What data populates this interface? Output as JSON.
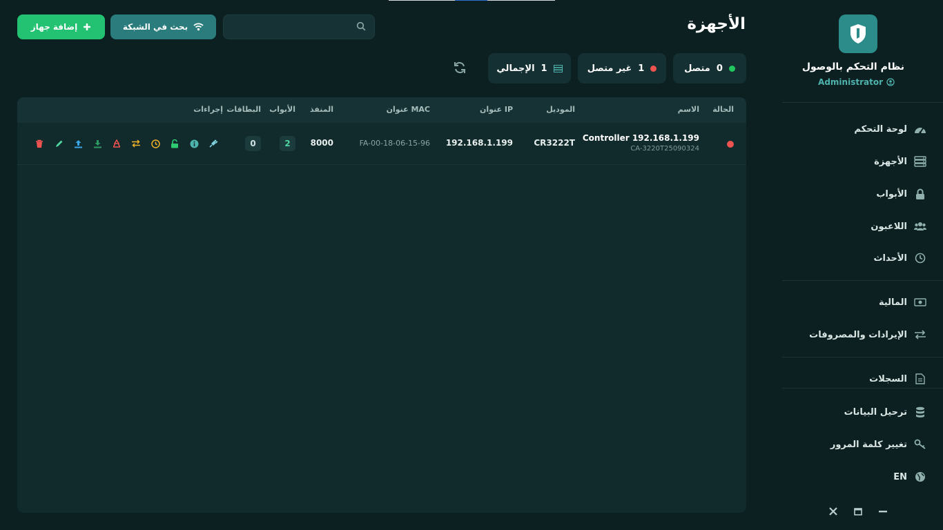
{
  "app": {
    "title": "نظام التحكم بالوصول",
    "role": "Administrator"
  },
  "nav": {
    "items": [
      {
        "label": "لوحة التحكم",
        "icon": "dashboard-icon"
      },
      {
        "label": "الأجهزة",
        "icon": "server-icon"
      },
      {
        "label": "الأبواب",
        "icon": "lock-icon"
      },
      {
        "label": "اللاعبون",
        "icon": "users-icon"
      },
      {
        "label": "الأحداث",
        "icon": "clock-icon"
      },
      {
        "label": "المالية",
        "icon": "money-icon"
      },
      {
        "label": "الإيرادات والمصروفات",
        "icon": "exchange-icon"
      },
      {
        "label": "السجلات",
        "icon": "document-icon"
      },
      {
        "label": "ترحيل البيانات",
        "icon": "database-icon"
      },
      {
        "label": "تغيير كلمة المرور",
        "icon": "key-icon"
      },
      {
        "label": "EN",
        "icon": "globe-icon"
      }
    ]
  },
  "page": {
    "title": "الأجهزة"
  },
  "toolbar": {
    "add_label": "إضافة جهاز",
    "scan_label": "بحث في الشبكة",
    "search_value": ""
  },
  "stats": {
    "online": {
      "count": "0",
      "label": "متصل"
    },
    "offline": {
      "count": "1",
      "label": "غير متصل"
    },
    "total": {
      "count": "1",
      "label": "الإجمالي"
    }
  },
  "colors": {
    "accent": "#23c172",
    "teal": "#2a7c7d",
    "online": "#22c55e",
    "offline": "#ef5350",
    "background": "#0c2022"
  },
  "table": {
    "headers": {
      "status": "الحالة",
      "name": "الاسم",
      "model": "الموديل",
      "ip": "عنوان IP",
      "mac": "عنوان MAC",
      "port": "المنفذ",
      "doors": "الأبواب",
      "cards": "البطاقات",
      "actions": "إجراءات"
    },
    "rows": [
      {
        "status": "offline",
        "name": "Controller 192.168.1.199",
        "serial": "CA-3220T25090324",
        "model": "CR3222T",
        "ip": "192.168.1.199",
        "mac": "FA-00-18-06-15-96",
        "port": "8000",
        "doors": "2",
        "cards": "0"
      }
    ],
    "actions": [
      "delete-icon",
      "edit-icon",
      "upload-icon",
      "download-icon",
      "recycle-icon",
      "sync-icon",
      "time-icon",
      "unlock-icon",
      "info-icon",
      "plug-icon"
    ]
  }
}
